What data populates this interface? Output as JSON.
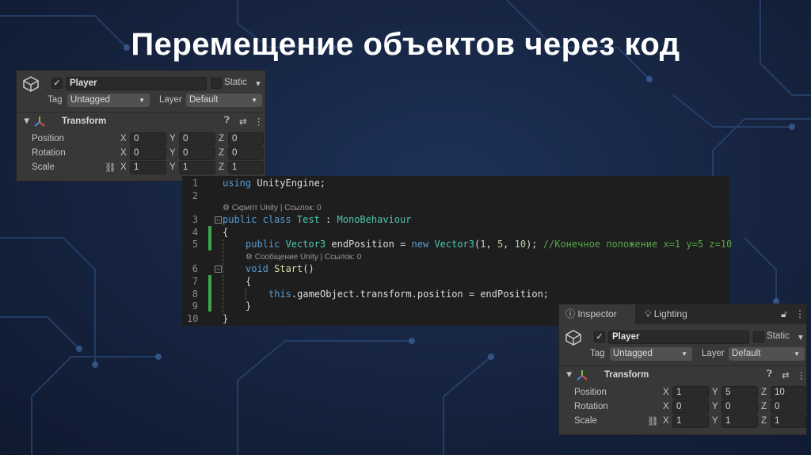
{
  "slide_title": "Перемещение объектов через код",
  "inspector_before": {
    "active": "✓",
    "name": "Player",
    "static_label": "Static",
    "tag_label": "Tag",
    "tag_value": "Untagged",
    "layer_label": "Layer",
    "layer_value": "Default",
    "component": "Transform",
    "rows": [
      {
        "label": "Position",
        "x": "0",
        "y": "0",
        "z": "0"
      },
      {
        "label": "Rotation",
        "x": "0",
        "y": "0",
        "z": "0"
      },
      {
        "label": "Scale",
        "x": "1",
        "y": "1",
        "z": "1"
      }
    ],
    "axis": {
      "x": "X",
      "y": "Y",
      "z": "Z"
    }
  },
  "inspector_after": {
    "tabs": [
      "Inspector",
      "Lighting"
    ],
    "active": "✓",
    "name": "Player",
    "static_label": "Static",
    "tag_label": "Tag",
    "tag_value": "Untagged",
    "layer_label": "Layer",
    "layer_value": "Default",
    "component": "Transform",
    "rows": [
      {
        "label": "Position",
        "x": "1",
        "y": "5",
        "z": "10"
      },
      {
        "label": "Rotation",
        "x": "0",
        "y": "0",
        "z": "0"
      },
      {
        "label": "Scale",
        "x": "1",
        "y": "1",
        "z": "1"
      }
    ],
    "axis": {
      "x": "X",
      "y": "Y",
      "z": "Z"
    }
  },
  "code": {
    "lines": [
      {
        "num": "1",
        "indent": 0,
        "tokens": [
          [
            "using",
            "kw"
          ],
          [
            " UnityEngine;",
            ""
          ]
        ]
      },
      {
        "num": "2",
        "indent": 0,
        "tokens": []
      },
      {
        "num": "",
        "indent": 0,
        "hint": "⚙ Скрипт Unity | Ссылок: 0"
      },
      {
        "num": "3",
        "indent": 0,
        "tokens": [
          [
            "public class ",
            "kw"
          ],
          [
            "Test",
            "ty"
          ],
          [
            " : ",
            ""
          ],
          [
            "MonoBehaviour",
            "ty"
          ]
        ]
      },
      {
        "num": "4",
        "indent": 0,
        "tokens": [
          [
            "{",
            ""
          ]
        ]
      },
      {
        "num": "5",
        "indent": 1,
        "tokens": [
          [
            "public ",
            "kw"
          ],
          [
            "Vector3",
            "ty"
          ],
          [
            " endPosition = ",
            ""
          ],
          [
            "new ",
            "kw"
          ],
          [
            "Vector3",
            "ty"
          ],
          [
            "(",
            ""
          ],
          [
            "1",
            "nm"
          ],
          [
            ", ",
            ""
          ],
          [
            "5",
            "nm"
          ],
          [
            ", ",
            ""
          ],
          [
            "10",
            "nm"
          ],
          [
            "); ",
            ""
          ],
          [
            "//Конечное положение x=1 y=5 z=10",
            "cm"
          ]
        ]
      },
      {
        "num": "",
        "indent": 1,
        "hint": "⚙ Сообщение Unity | Ссылок: 0"
      },
      {
        "num": "6",
        "indent": 1,
        "tokens": [
          [
            "void ",
            "kw"
          ],
          [
            "Start",
            "fn"
          ],
          [
            "()",
            ""
          ]
        ]
      },
      {
        "num": "7",
        "indent": 1,
        "tokens": [
          [
            "{",
            ""
          ]
        ]
      },
      {
        "num": "8",
        "indent": 2,
        "tokens": [
          [
            "this",
            "kw"
          ],
          [
            ".gameObject.transform.position = endPosition;",
            ""
          ]
        ]
      },
      {
        "num": "9",
        "indent": 1,
        "tokens": [
          [
            "}",
            ""
          ]
        ]
      },
      {
        "num": "10",
        "indent": 0,
        "tokens": [
          [
            "}",
            ""
          ]
        ]
      }
    ]
  }
}
